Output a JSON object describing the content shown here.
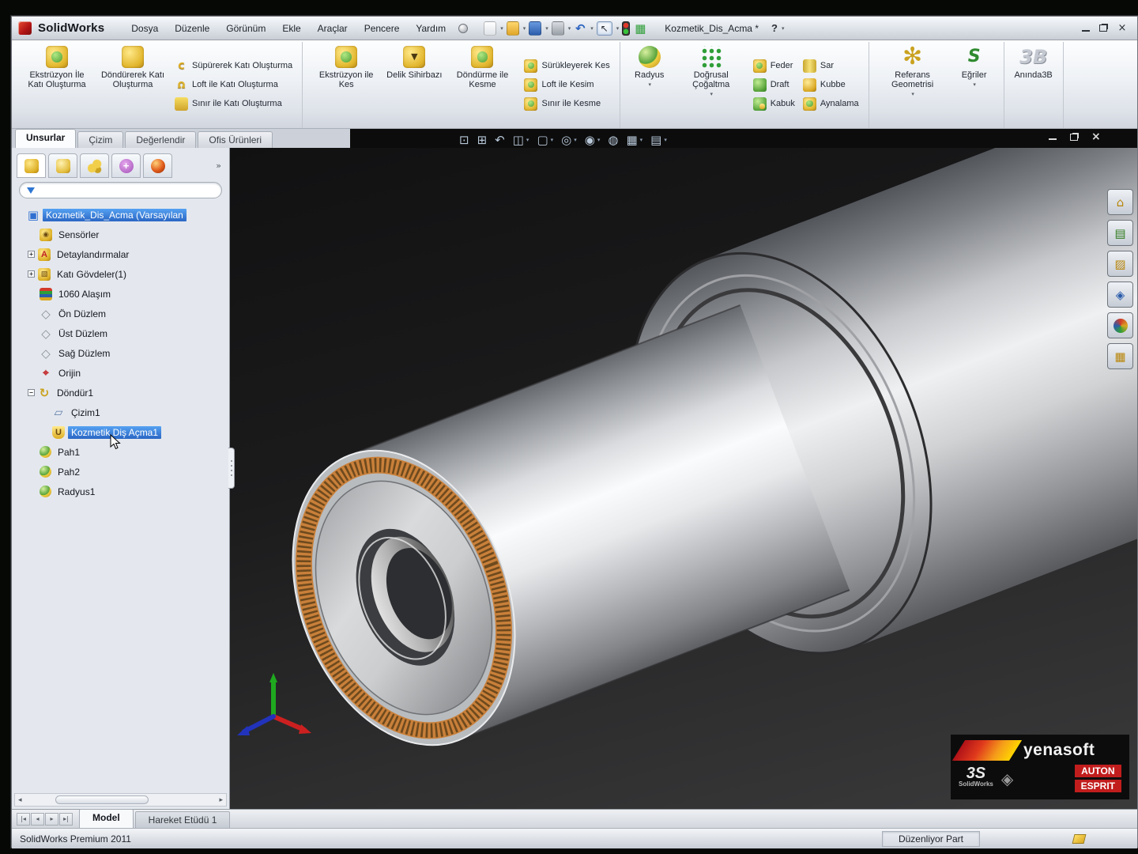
{
  "window": {
    "app": "SolidWorks",
    "doc_title": "Kozmetik_Dis_Acma *",
    "help_label": "?"
  },
  "menubar": [
    "Dosya",
    "Düzenle",
    "Görünüm",
    "Ekle",
    "Araçlar",
    "Pencere",
    "Yardım"
  ],
  "quickbar": [
    "new-document-icon",
    "open-icon",
    "save-icon",
    "print-icon",
    "undo-icon",
    "select-icon",
    "rebuild-icon",
    "options-icon"
  ],
  "ribbon": {
    "groups": [
      {
        "big": [
          {
            "label": "Ekstrüzyon İle Katı Oluşturma",
            "icon": "boss-extrude-icon"
          },
          {
            "label": "Döndürerek Katı Oluşturma",
            "icon": "revolved-boss-icon"
          }
        ],
        "small_cols": [
          [
            {
              "label": "Süpürerek Katı Oluşturma",
              "icon": "swept-boss-icon"
            },
            {
              "label": "Loft ile Katı Oluşturma",
              "icon": "lofted-boss-icon"
            },
            {
              "label": "Sınır ile Katı Oluşturma",
              "icon": "boundary-boss-icon"
            }
          ]
        ]
      },
      {
        "big": [
          {
            "label": "Ekstrüzyon ile Kes",
            "icon": "cut-extrude-icon"
          },
          {
            "label": "Delik Sihirbazı",
            "icon": "hole-wizard-icon"
          },
          {
            "label": "Döndürme ile Kesme",
            "icon": "revolved-cut-icon"
          }
        ],
        "small_cols": [
          [
            {
              "label": "Sürükleyerek Kes",
              "icon": "swept-cut-icon"
            },
            {
              "label": "Loft ile Kesim",
              "icon": "lofted-cut-icon"
            },
            {
              "label": "Sınır ile Kesme",
              "icon": "boundary-cut-icon"
            }
          ]
        ]
      },
      {
        "big": [
          {
            "label": "Radyus",
            "icon": "fillet-icon",
            "dropdown": true
          },
          {
            "label": "Doğrusal Çoğaltma",
            "icon": "linear-pattern-icon",
            "dropdown": true
          }
        ],
        "small_cols": [
          [
            {
              "label": "Feder",
              "icon": "rib-icon"
            },
            {
              "label": "Draft",
              "icon": "draft-icon"
            },
            {
              "label": "Kabuk",
              "icon": "shell-icon"
            }
          ],
          [
            {
              "label": "Sar",
              "icon": "wrap-icon"
            },
            {
              "label": "Kubbe",
              "icon": "dome-icon"
            },
            {
              "label": "Aynalama",
              "icon": "mirror-icon"
            }
          ]
        ]
      },
      {
        "big": [
          {
            "label": "Referans Geometrisi",
            "icon": "reference-geometry-icon",
            "dropdown": true
          },
          {
            "label": "Eğriler",
            "icon": "curves-icon",
            "dropdown": true
          }
        ],
        "small_cols": []
      },
      {
        "big": [
          {
            "label": "Anında3B",
            "icon": "instant3d-icon"
          }
        ],
        "small_cols": []
      }
    ]
  },
  "feature_tabs": [
    {
      "label": "Unsurlar",
      "active": true
    },
    {
      "label": "Çizim",
      "active": false
    },
    {
      "label": "Değerlendir",
      "active": false
    },
    {
      "label": "Ofis Ürünleri",
      "active": false
    }
  ],
  "panel": {
    "tab_icons": [
      "feature-manager-icon",
      "property-manager-icon",
      "configuration-manager-icon",
      "dimxpert-manager-icon",
      "display-manager-icon"
    ],
    "overflow_label": "»"
  },
  "tree": [
    {
      "label": "Kozmetik_Dis_Acma (Varsayılan",
      "icon": "part",
      "level": 0,
      "selected": true
    },
    {
      "label": "Sensörler",
      "icon": "sensors",
      "level": 1
    },
    {
      "label": "Detaylandırmalar",
      "icon": "annotations",
      "level": 1,
      "expander": "+"
    },
    {
      "label": "Katı Gövdeler(1)",
      "icon": "solid-bodies",
      "level": 1,
      "expander": "+"
    },
    {
      "label": "1060 Alaşım",
      "icon": "material",
      "level": 1
    },
    {
      "label": "Ön Düzlem",
      "icon": "plane",
      "level": 1
    },
    {
      "label": "Üst Düzlem",
      "icon": "plane",
      "level": 1
    },
    {
      "label": "Sağ Düzlem",
      "icon": "plane",
      "level": 1
    },
    {
      "label": "Orijin",
      "icon": "origin",
      "level": 1
    },
    {
      "label": "Döndür1",
      "icon": "revolve",
      "level": 1,
      "expander": "−"
    },
    {
      "label": "Çizim1",
      "icon": "sketch",
      "level": 2
    },
    {
      "label": "Kozmetik Diş Açma1",
      "icon": "cosmetic-thread",
      "level": 2,
      "selected": true
    },
    {
      "label": "Pah1",
      "icon": "chamfer",
      "level": 1
    },
    {
      "label": "Pah2",
      "icon": "chamfer",
      "level": 1
    },
    {
      "label": "Radyus1",
      "icon": "fillet",
      "level": 1
    }
  ],
  "headsup": [
    {
      "icon": "zoom-to-fit-icon"
    },
    {
      "icon": "zoom-to-area-icon"
    },
    {
      "icon": "previous-view-icon"
    },
    {
      "icon": "section-view-icon",
      "dropdown": true
    },
    {
      "icon": "view-orientation-icon",
      "dropdown": true
    },
    {
      "icon": "display-style-icon",
      "dropdown": true
    },
    {
      "icon": "hide-show-items-icon",
      "dropdown": true
    },
    {
      "icon": "edit-appearance-icon"
    },
    {
      "icon": "apply-scene-icon",
      "dropdown": true
    },
    {
      "icon": "view-settings-icon",
      "dropdown": true
    }
  ],
  "taskpane": [
    "solidworks-resources-icon",
    "design-library-icon",
    "file-explorer-icon",
    "search-icon",
    "appearances-icon",
    "custom-properties-icon"
  ],
  "bottom_tabs": {
    "items": [
      {
        "label": "Model",
        "active": true
      },
      {
        "label": "Hareket Etüdü 1",
        "active": false
      }
    ]
  },
  "statusbar": {
    "product": "SolidWorks Premium 2011",
    "mode": "Düzenliyor Part"
  },
  "brand": {
    "title": "yenasoft",
    "ds": "3S",
    "ds_sub": "SolidWorks",
    "badges": [
      "AUTON",
      "ESPRIT"
    ]
  },
  "colors": {
    "selection_blue": "#2f76d2",
    "knurl_orange": "#c9803a",
    "accent_gold": "#e2b62c",
    "accent_green": "#57a33a",
    "viewport_dark": "#1b1b1c"
  }
}
